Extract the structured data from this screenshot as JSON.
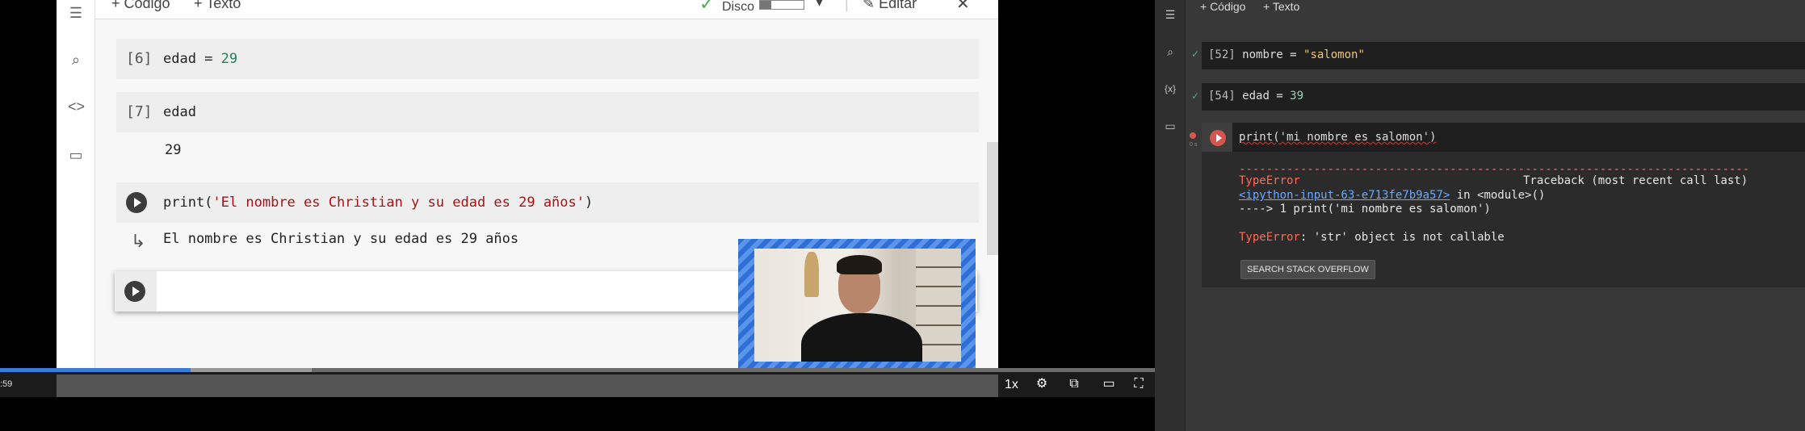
{
  "video": {
    "toolbar": {
      "add_code": "+ Código",
      "add_text": "+ Texto",
      "disk_check": "✓",
      "disk_label": "Disco",
      "disk_fill_fraction": 0.25,
      "dropdown": "▾",
      "edit": "✎ Editar",
      "close": "✕"
    },
    "cells": [
      {
        "num": "[6]",
        "code_var": "edad = ",
        "code_num": "29"
      },
      {
        "num": "[7]",
        "code_var": "edad",
        "output": "29"
      }
    ],
    "print_cell": {
      "code_prefix": "print(",
      "code_string": "'El nombre es Christian y su edad es 29 años'",
      "code_suffix": ")",
      "output": "El nombre es Christian y su edad es 29 años"
    },
    "player": {
      "time": ":59",
      "progress_fraction": 0.165,
      "buffer_fraction": 0.27,
      "speed": "1x"
    }
  },
  "colab": {
    "toolbar": {
      "add_code": "+ Código",
      "add_text": "+ Texto"
    },
    "cells": [
      {
        "num": "[52]",
        "code_var": "nombre = ",
        "code_str": "\"salomon\""
      },
      {
        "num": "[54]",
        "code_var": "edad = ",
        "code_num": "39"
      }
    ],
    "active_cell": {
      "code": "print('mi nombre es salomon')",
      "elapsed": "0 s",
      "traceback": {
        "dashes": "---------------------------------------------------------------------------",
        "error_type": "TypeError",
        "header_right": "Traceback (most recent call last)",
        "link": "<ipython-input-63-e713fe7b9a57>",
        "in_module": " in <module>()",
        "arrow_line": "----> 1 print('mi nombre es salomon')",
        "error_label": "TypeError",
        "error_message": ": 'str' object is not callable"
      },
      "stack_button": "SEARCH STACK OVERFLOW"
    }
  }
}
